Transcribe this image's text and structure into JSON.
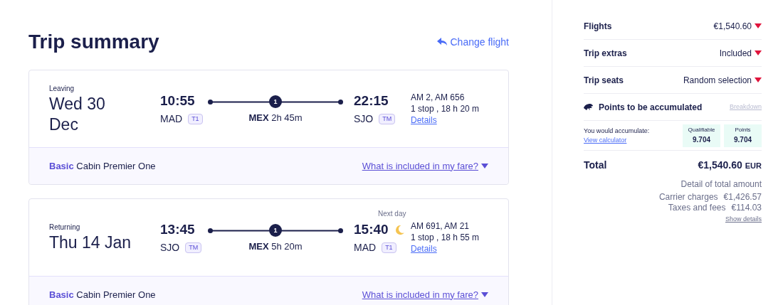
{
  "title": "Trip summary",
  "change_flight": "Change flight",
  "flights": [
    {
      "label": "Leaving",
      "date": "Wed 30 Dec",
      "depart_time": "10:55",
      "depart_airport": "MAD",
      "depart_terminal": "T1",
      "stops": "1",
      "via": "MEX",
      "layover": "2h 45m",
      "arrive_time": "22:15",
      "arrive_airport": "SJO",
      "arrive_terminal": "TM",
      "overnight": false,
      "flight_numbers": "AM 2, AM 656",
      "duration": "1 stop , 18 h 20 m",
      "details": "Details",
      "fare": "Basic",
      "cabin": "Cabin Premier One",
      "fare_link": "What is included in my fare?"
    },
    {
      "label": "Returning",
      "date": "Thu 14 Jan",
      "depart_time": "13:45",
      "depart_airport": "SJO",
      "depart_terminal": "TM",
      "stops": "1",
      "via": "MEX",
      "layover": "5h 20m",
      "arrive_note": "Next day",
      "arrive_time": "15:40",
      "arrive_airport": "MAD",
      "arrive_terminal": "T1",
      "overnight": true,
      "flight_numbers": "AM 691, AM 21",
      "duration": "1 stop , 18 h 55 m",
      "details": "Details",
      "fare": "Basic",
      "cabin": "Cabin Premier One",
      "fare_link": "What is included in my fare?"
    }
  ],
  "summary": {
    "rows": [
      {
        "label": "Flights",
        "value": "€1,540.60"
      },
      {
        "label": "Trip extras",
        "value": "Included"
      },
      {
        "label": "Trip seats",
        "value": "Random selection"
      }
    ],
    "points": {
      "title": "Points to be accumulated",
      "breakdown": "Breakdown",
      "text": "You would accumulate:",
      "calculator": "View calculator",
      "boxes": [
        {
          "label": "Qualifiable",
          "value": "9.704"
        },
        {
          "label": "Points",
          "value": "9.704"
        }
      ]
    },
    "total": {
      "label": "Total",
      "amount": "€1,540.60",
      "currency": "EUR"
    },
    "detail_title": "Detail of total amount",
    "charges": [
      {
        "label": "Carrier charges",
        "value": "€1,426.57"
      },
      {
        "label": "Taxes and fees",
        "value": "€114.03"
      }
    ],
    "show_details": "Show details"
  }
}
